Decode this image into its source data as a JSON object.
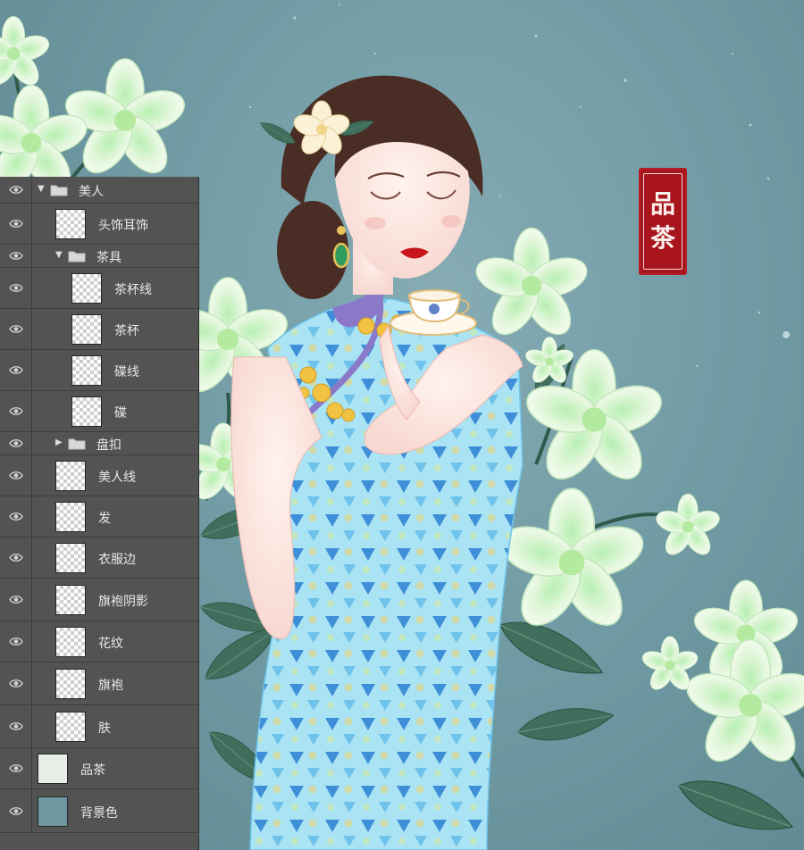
{
  "seal": {
    "chars": [
      "品",
      "茶"
    ]
  },
  "layers": [
    {
      "id": "group-meiren",
      "name": "美人",
      "type": "group-open",
      "indent": 0
    },
    {
      "id": "layer-toushi",
      "name": "头饰耳饰",
      "type": "layer",
      "indent": 0
    },
    {
      "id": "group-chaju",
      "name": "茶具",
      "type": "group-open",
      "indent": 1
    },
    {
      "id": "layer-chabeixian",
      "name": "茶杯线",
      "type": "layer",
      "indent": 1
    },
    {
      "id": "layer-chabei",
      "name": "茶杯",
      "type": "layer",
      "indent": 1
    },
    {
      "id": "layer-diexian",
      "name": "碟线",
      "type": "layer",
      "indent": 1
    },
    {
      "id": "layer-die",
      "name": "碟",
      "type": "layer",
      "indent": 1
    },
    {
      "id": "group-pankou",
      "name": "盘扣",
      "type": "group-closed",
      "indent": 1
    },
    {
      "id": "layer-meirenxian",
      "name": "美人线",
      "type": "layer",
      "indent": 0
    },
    {
      "id": "layer-fa",
      "name": "发",
      "type": "layer",
      "indent": 0
    },
    {
      "id": "layer-yifubian",
      "name": "衣服边",
      "type": "layer",
      "indent": 0
    },
    {
      "id": "layer-qipaoyinying",
      "name": "旗袍阴影",
      "type": "layer",
      "indent": 0
    },
    {
      "id": "layer-huawen",
      "name": "花纹",
      "type": "layer",
      "indent": 0
    },
    {
      "id": "layer-qipao",
      "name": "旗袍",
      "type": "layer",
      "indent": 0
    },
    {
      "id": "layer-fu",
      "name": "肤",
      "type": "layer",
      "indent": 0
    },
    {
      "id": "layer-pincha",
      "name": "品茶",
      "type": "layer-top",
      "indent": -1
    },
    {
      "id": "layer-beijingse",
      "name": "背景色",
      "type": "layer-top",
      "indent": -1
    }
  ],
  "colors": {
    "panel_bg": "#535353",
    "panel_border": "#3d3d3d",
    "canvas_bg": "#729ca5",
    "seal_red": "#a8141c",
    "qipao_blue": "#8fd4ee",
    "flower_green": "#e3f7dc"
  },
  "icons": {
    "visibility": "eye-icon",
    "group": "folder-icon",
    "expand_open": "caret-down-icon",
    "expand_closed": "caret-right-icon"
  }
}
